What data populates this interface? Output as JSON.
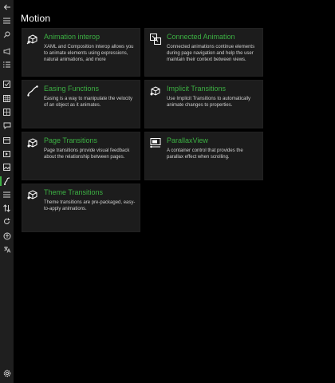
{
  "header": {
    "title": "Motion"
  },
  "sidebar": {
    "icons": [
      "back-arrow-icon",
      "hamburger-menu-icon",
      "search-icon",
      "megaphone-icon",
      "list-icon",
      "checkbox-icon",
      "grid-icon",
      "collection-icon",
      "chat-bubble-icon",
      "date-icon",
      "media-icon",
      "image-icon",
      "motion-icon",
      "menu-lines-icon",
      "sort-icon",
      "rotate-icon",
      "accessibility-icon",
      "language-icon",
      "settings-gear-icon"
    ],
    "active": "motion-icon"
  },
  "cards": [
    {
      "title": "Animation interop",
      "description": "XAML and Composition interop allows you to animate elements using expressions, natural animations, and more",
      "icon": "animation-cube-icon"
    },
    {
      "title": "Connected Animation",
      "description": "Connected animations continue elements during page navigation and help the user maintain their context between views.",
      "icon": "connected-animation-icon"
    },
    {
      "title": "Easing Functions",
      "description": "Easing is a way to manipulate the velocity of an object as it animates.",
      "icon": "easing-curve-icon"
    },
    {
      "title": "Implicit Transitions",
      "description": "Use Implicit Transitions to automatically animate changes to properties.",
      "icon": "implicit-transition-cube-icon"
    },
    {
      "title": "Page Transitions",
      "description": "Page transitions provide visual feedback about the relationship between pages.",
      "icon": "page-transition-cube-icon"
    },
    {
      "title": "ParallaxView",
      "description": "A container control that provides the parallax effect when scrolling.",
      "icon": "parallax-view-icon"
    },
    {
      "title": "Theme Transitions",
      "description": "Theme transitions are pre-packaged, easy-to-apply animations.",
      "icon": "theme-transition-cube-icon"
    }
  ],
  "colors": {
    "accent": "#3cb043",
    "card_background": "#1c1c1c",
    "sidebar_background": "#1f1f1f",
    "page_background": "#000000"
  }
}
